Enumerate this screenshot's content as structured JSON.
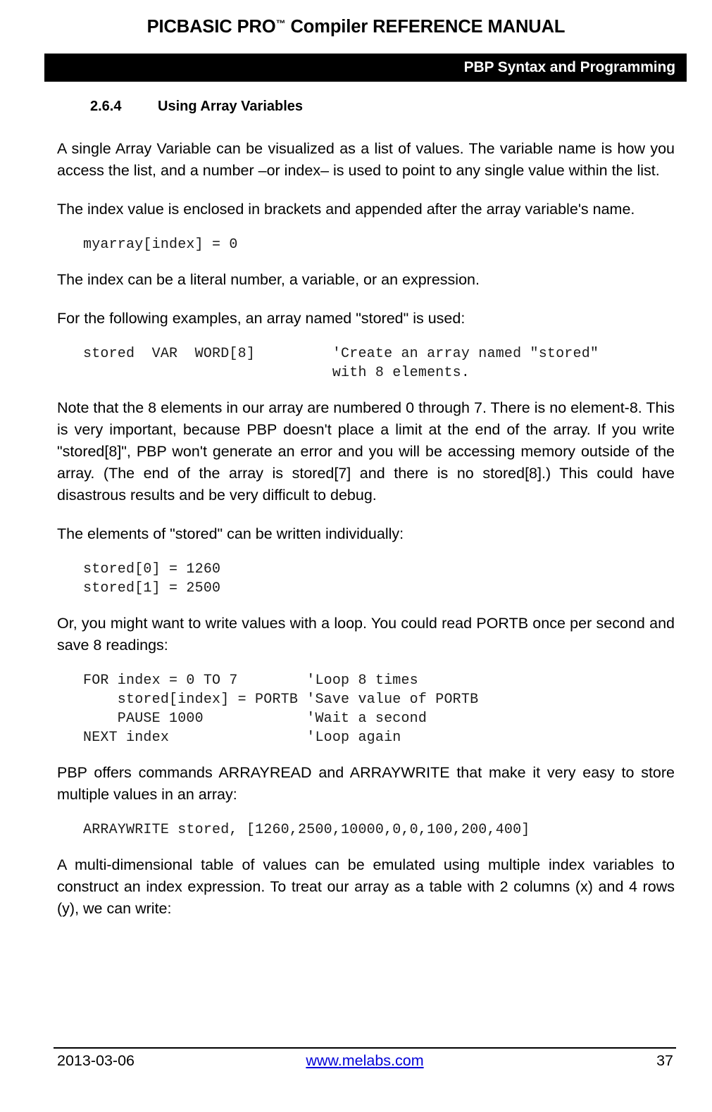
{
  "header": {
    "title_main": "PICBASIC PRO",
    "title_tm": "™",
    "title_rest": " Compiler REFERENCE MANUAL",
    "bar_text": "PBP Syntax and Programming",
    "bar_color": "#000000"
  },
  "section": {
    "number": "2.6.4",
    "title": "Using Array Variables"
  },
  "body": {
    "para1": "A single Array Variable can be visualized as a list of values.  The variable name is how you access the list, and a number –or index– is used to point to any single value within the list.",
    "para2": "The index value is enclosed in brackets and appended after the array variable's name.",
    "code1": "myarray[index] = 0",
    "para3": "The index can be a literal number, a variable, or an expression.",
    "para4": "For the following examples, an array named \"stored\" is used:",
    "code2": "stored  VAR  WORD[8]         'Create an array named \"stored\"\n                             with 8 elements.",
    "para5": "Note that the 8 elements in our array are numbered 0 through 7.  There is no element-8.  This is very important, because PBP doesn't place a limit at the end of the array.  If you write \"stored[8]\", PBP won't generate an error and you will be accessing memory outside of the array.  (The end of the array is stored[7] and there is no stored[8].)  This could have disastrous results and be very difficult to debug.",
    "para6": "The elements of \"stored\" can be written individually:",
    "code3": "stored[0] = 1260\nstored[1] = 2500",
    "para7": "Or, you might want to write values with a loop.  You could read PORTB once per second and save 8 readings:",
    "code4": "FOR index = 0 TO 7        'Loop 8 times\n    stored[index] = PORTB 'Save value of PORTB\n    PAUSE 1000            'Wait a second\nNEXT index                'Loop again",
    "para8": "PBP offers commands ARRAYREAD and ARRAYWRITE that make it very easy to store multiple values in an array:",
    "code5": "ARRAYWRITE stored, [1260,2500,10000,0,0,100,200,400]",
    "para9": "A multi-dimensional table of values can be emulated using multiple index variables to construct an index expression.  To treat our array as a table with 2 columns (x) and 4 rows (y), we can write:"
  },
  "footer": {
    "date": "2013-03-06",
    "link": "www.melabs.com",
    "link_color": "#0000d8",
    "page_number": "37"
  }
}
